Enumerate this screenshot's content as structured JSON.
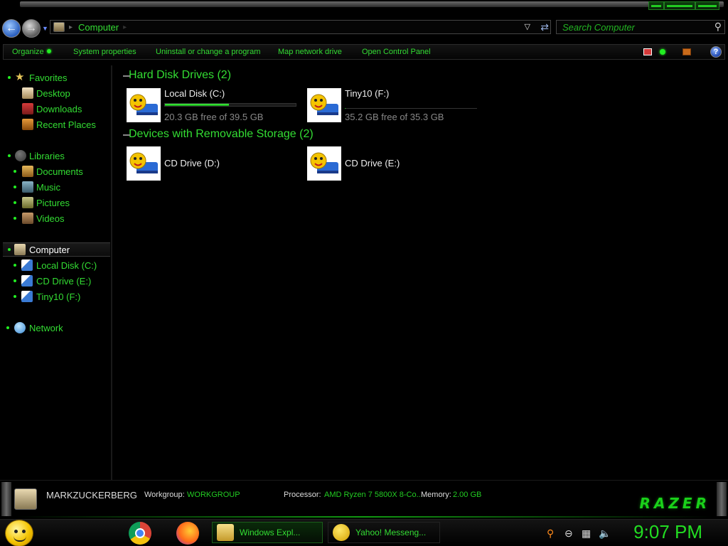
{
  "address_bar": {
    "crumb": "Computer",
    "search_placeholder": "Search Computer"
  },
  "command_bar": {
    "organize": "Organize",
    "system_properties": "System properties",
    "uninstall": "Uninstall or change a program",
    "map_drive": "Map network drive",
    "control_panel": "Open Control Panel",
    "help": "?"
  },
  "sidebar": {
    "favorites": {
      "label": "Favorites",
      "items": [
        {
          "label": "Desktop"
        },
        {
          "label": "Downloads"
        },
        {
          "label": "Recent Places"
        }
      ]
    },
    "libraries": {
      "label": "Libraries",
      "items": [
        {
          "label": "Documents"
        },
        {
          "label": "Music"
        },
        {
          "label": "Pictures"
        },
        {
          "label": "Videos"
        }
      ]
    },
    "computer": {
      "label": "Computer",
      "items": [
        {
          "label": "Local Disk (C:)"
        },
        {
          "label": "CD Drive (E:)"
        },
        {
          "label": "Tiny10 (F:)"
        }
      ]
    },
    "network": {
      "label": "Network"
    }
  },
  "groups": [
    {
      "title": "Hard Disk Drives (2)",
      "drives": [
        {
          "name": "Local Disk (C:)",
          "free": "20.3 GB free of 39.5 GB",
          "used_fraction": 0.49
        },
        {
          "name": "Tiny10 (F:)",
          "free": "35.2 GB free of 35.3 GB",
          "used_fraction": 0.003
        }
      ]
    },
    {
      "title": "Devices with Removable Storage (2)",
      "drives": [
        {
          "name": "CD Drive (D:)"
        },
        {
          "name": "CD Drive (E:)"
        }
      ]
    }
  ],
  "details": {
    "computer_name": "MARKZUCKERBERG",
    "workgroup_label": "Workgroup:",
    "workgroup_value": "WORKGROUP",
    "processor_label": "Processor:",
    "processor_value": "AMD Ryzen 7 5800X 8-Co...",
    "memory_label": "Memory:",
    "memory_value": "2.00 GB",
    "brand": "RAZER"
  },
  "taskbar": {
    "tasks": [
      {
        "label": "Windows Expl..."
      },
      {
        "label": "Yahoo! Messeng..."
      }
    ],
    "clock": "9:07 PM"
  },
  "colors": {
    "accent": "#33dd33",
    "background": "#000000"
  }
}
